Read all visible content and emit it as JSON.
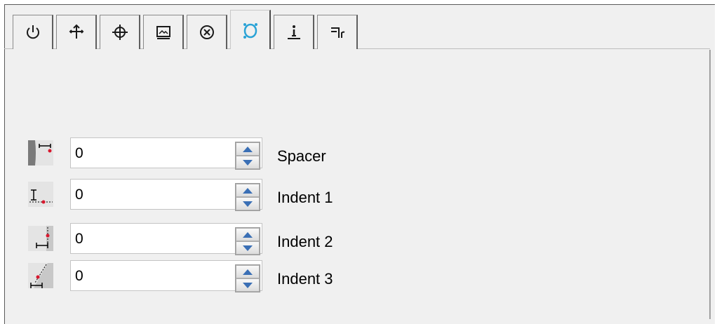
{
  "tabs": [
    {
      "icon": "power-icon",
      "active": false
    },
    {
      "icon": "move-arrows-icon",
      "active": false
    },
    {
      "icon": "crosshair-icon",
      "active": false
    },
    {
      "icon": "picture-icon",
      "active": false
    },
    {
      "icon": "cancel-circle-icon",
      "active": false
    },
    {
      "icon": "spacing-node-icon",
      "active": true
    },
    {
      "icon": "info-underline-icon",
      "active": false
    },
    {
      "icon": "flow-connector-icon",
      "active": false
    }
  ],
  "rows": [
    {
      "icon": "spacer-icon",
      "value": "0",
      "label": "Spacer"
    },
    {
      "icon": "indent1-icon",
      "value": "0",
      "label": "Indent 1"
    },
    {
      "icon": "indent2-icon",
      "value": "0",
      "label": "Indent 2"
    },
    {
      "icon": "indent3-icon",
      "value": "0",
      "label": "Indent 3"
    }
  ],
  "colors": {
    "active_tab_icon": "#2aa3d6",
    "inactive_tab_icon": "#1a1a1a",
    "marker_red": "#d8182e",
    "spin_arrow": "#3a6fb5"
  }
}
